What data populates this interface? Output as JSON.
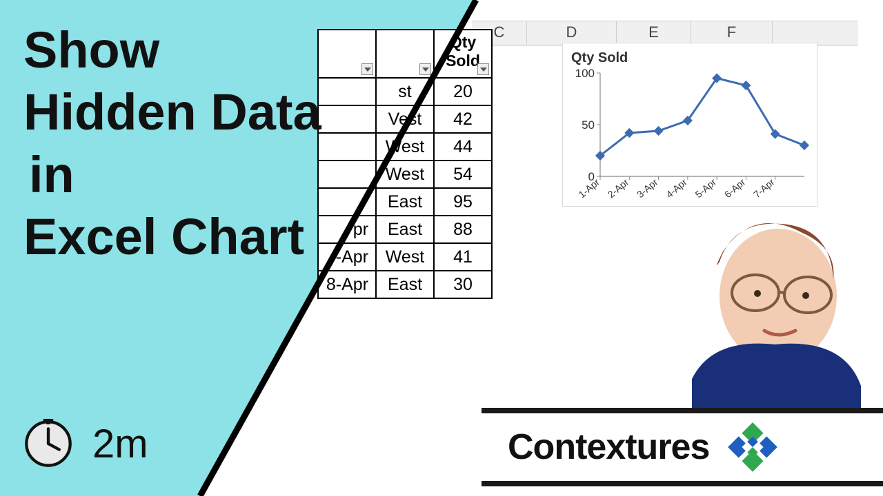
{
  "title": {
    "line1": "Show",
    "line2": "Hidden Data",
    "line3": "in",
    "line4": "Excel Chart"
  },
  "duration": "2m",
  "brand": "Contextures",
  "columns": {
    "C": "C",
    "D": "D",
    "E": "E",
    "F": "F"
  },
  "table": {
    "headers": {
      "date": "",
      "region": "",
      "qty1": "Qty",
      "qty2": "Sold"
    },
    "rows": [
      {
        "date": "",
        "region": "st",
        "qty": "20"
      },
      {
        "date": "",
        "region": "Vest",
        "qty": "42"
      },
      {
        "date": "",
        "region": "West",
        "qty": "44"
      },
      {
        "date": "",
        "region": "West",
        "qty": "54"
      },
      {
        "date": "",
        "region": "East",
        "qty": "95"
      },
      {
        "date": "pr",
        "region": "East",
        "qty": "88"
      },
      {
        "date": "-Apr",
        "region": "West",
        "qty": "41"
      },
      {
        "date": "8-Apr",
        "region": "East",
        "qty": "30"
      }
    ]
  },
  "chart_data": {
    "type": "line",
    "title": "Qty Sold",
    "xlabel": "",
    "ylabel": "",
    "ylim": [
      0,
      100
    ],
    "yticks": [
      0,
      50,
      100
    ],
    "categories": [
      "1-Apr",
      "2-Apr",
      "3-Apr",
      "4-Apr",
      "5-Apr",
      "6-Apr",
      "7-Apr"
    ],
    "values": [
      20,
      42,
      44,
      54,
      95,
      88,
      41,
      30
    ]
  },
  "colors": {
    "accent_cyan": "#8ce2e6",
    "chart_line": "#3d6bb3",
    "logo_green": "#2fa84f",
    "logo_blue": "#1f5fbf"
  }
}
